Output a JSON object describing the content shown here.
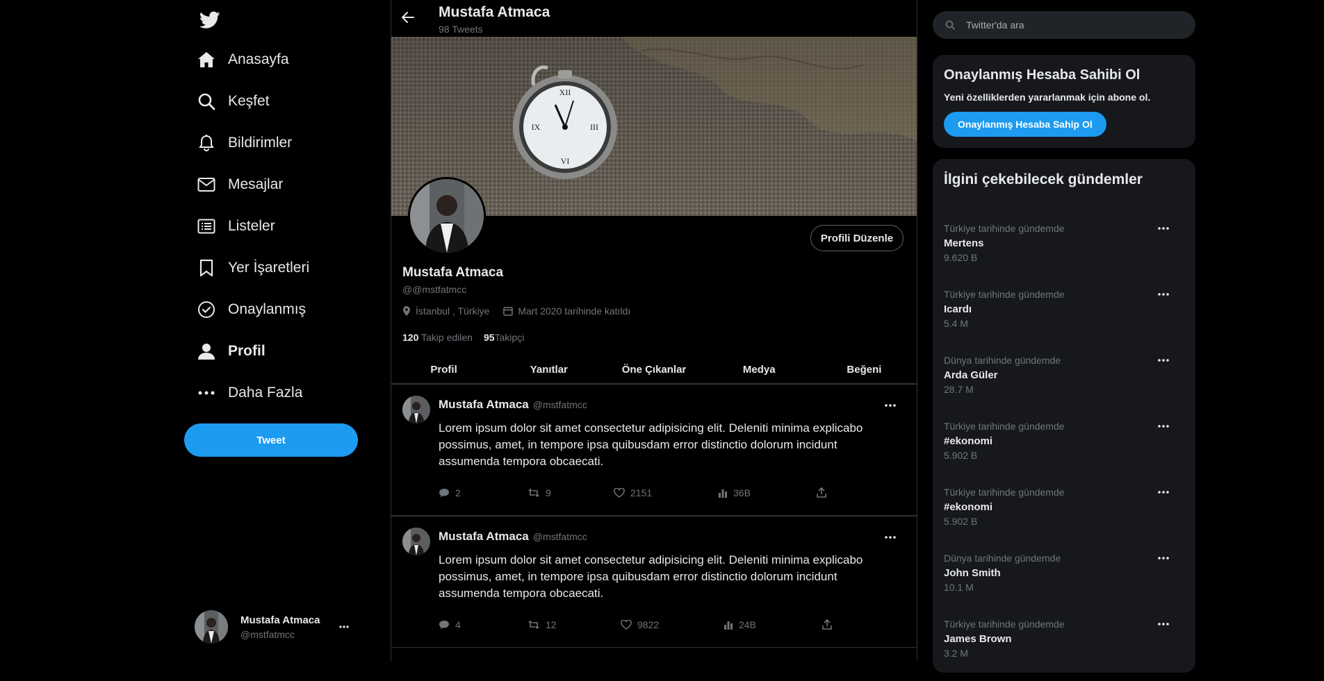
{
  "nav": {
    "items": [
      {
        "label": "Anasayfa",
        "icon": "home-icon"
      },
      {
        "label": "Keşfet",
        "icon": "search-icon"
      },
      {
        "label": "Bildirimler",
        "icon": "bell-icon"
      },
      {
        "label": "Mesajlar",
        "icon": "mail-icon"
      },
      {
        "label": "Listeler",
        "icon": "list-icon"
      },
      {
        "label": "Yer İşaretleri",
        "icon": "bookmark-icon"
      },
      {
        "label": "Onaylanmış",
        "icon": "verified-icon"
      },
      {
        "label": "Profil",
        "icon": "person-icon"
      },
      {
        "label": "Daha Fazla",
        "icon": "more-icon"
      }
    ],
    "tweet_button": "Tweet"
  },
  "account": {
    "name": "Mustafa Atmaca",
    "handle": "@mstfatmcc"
  },
  "topbar": {
    "name": "Mustafa Atmaca",
    "tweet_count": "98 Tweets"
  },
  "profile": {
    "edit_button": "Profili Düzenle",
    "name": "Mustafa Atmaca",
    "handle": "@@mstfatmcc",
    "location": "İstanbul , Türkiye",
    "joined": "Mart 2020 tarihinde katıldı",
    "following_count": "120",
    "following_label": "Takip edilen",
    "followers_count": "95",
    "followers_label": "Takipçi"
  },
  "tabs": [
    "Profil",
    "Yanıtlar",
    "Öne Çıkanlar",
    "Medya",
    "Beğeni"
  ],
  "tweets": [
    {
      "name": "Mustafa Atmaca",
      "handle": "@mstfatmcc",
      "text": "Lorem ipsum dolor sit amet consectetur adipisicing elit. Deleniti minima explicabo possimus, amet, in tempore ipsa quibusdam error distinctio dolorum incidunt assumenda tempora obcaecati.",
      "replies": "2",
      "retweets": "9",
      "likes": "2151",
      "views": "36B"
    },
    {
      "name": "Mustafa Atmaca",
      "handle": "@mstfatmcc",
      "text": "Lorem ipsum dolor sit amet consectetur adipisicing elit. Deleniti minima explicabo possimus, amet, in tempore ipsa quibusdam error distinctio dolorum incidunt assumenda tempora obcaecati.",
      "replies": "4",
      "retweets": "12",
      "likes": "9822",
      "views": "24B"
    }
  ],
  "search": {
    "placeholder": "Twitter'da ara"
  },
  "verified_card": {
    "title": "Onaylanmış Hesaba Sahibi Ol",
    "subtitle": "Yeni özelliklerden yararlanmak için abone ol.",
    "button": "Onaylanmış Hesaba Sahip Ol"
  },
  "trends_card": {
    "title": "İlgini çekebilecek gündemler",
    "items": [
      {
        "context": "Türkiye tarihinde gündemde",
        "name": "Mertens",
        "count": "9.620 B"
      },
      {
        "context": "Türkiye tarihinde gündemde",
        "name": "Icardı",
        "count": "5.4 M"
      },
      {
        "context": "Dünya tarihinde gündemde",
        "name": "Arda Güler",
        "count": "28.7 M"
      },
      {
        "context": "Türkiye tarihinde gündemde",
        "name": "#ekonomi",
        "count": "5.902 B"
      },
      {
        "context": "Türkiye tarihinde gündemde",
        "name": "#ekonomi",
        "count": "5.902 B"
      },
      {
        "context": "Dünya tarihinde gündemde",
        "name": "John Smith",
        "count": "10.1 M"
      },
      {
        "context": "Türkiye tarihinde gündemde",
        "name": "James Brown",
        "count": "3.2 M"
      }
    ]
  },
  "colors": {
    "accent": "#1d9bf0",
    "background": "#000000",
    "card": "#16181c",
    "muted": "#71767b",
    "border": "#2f3336"
  }
}
